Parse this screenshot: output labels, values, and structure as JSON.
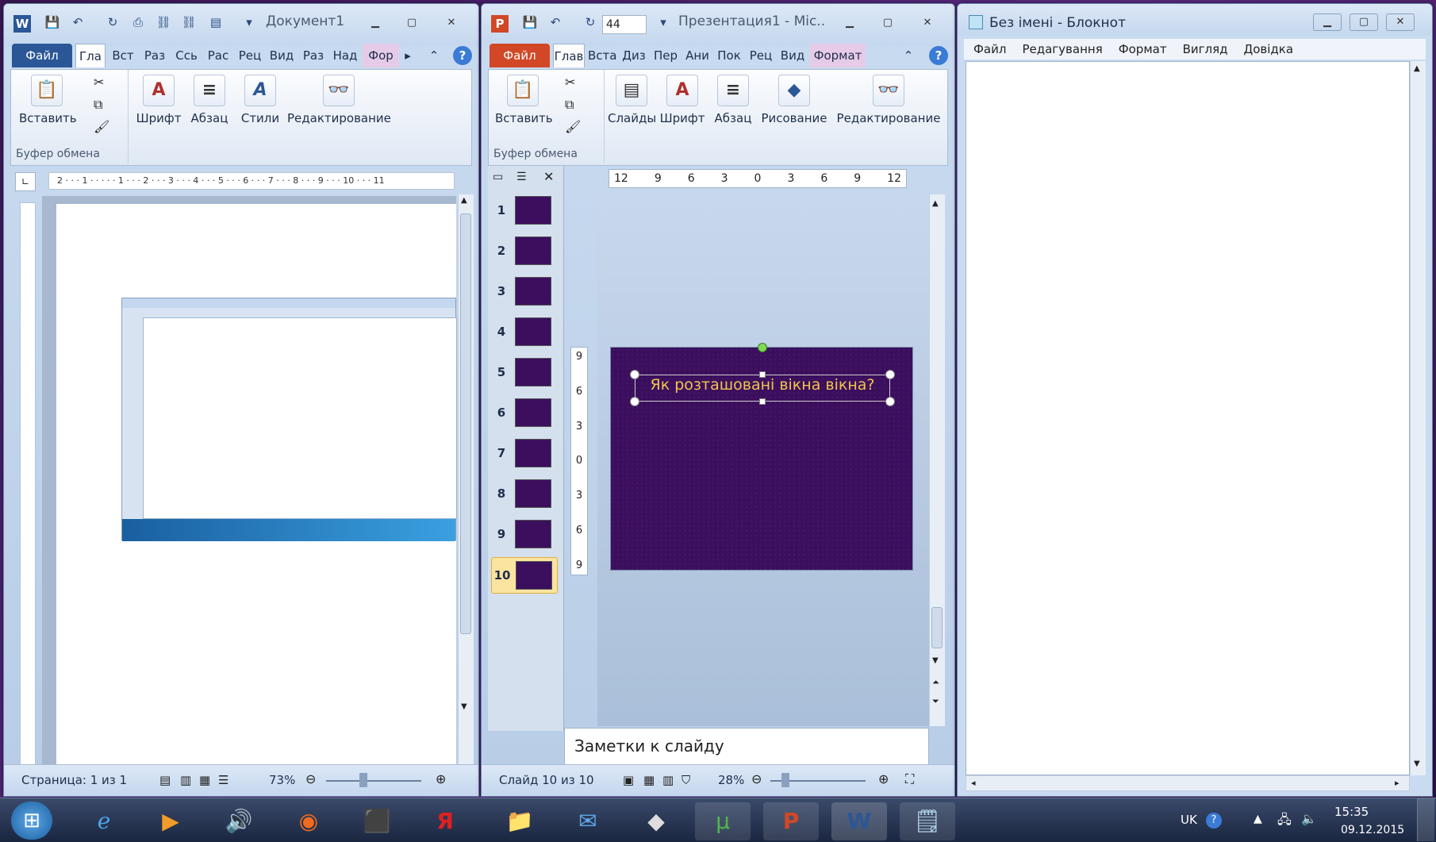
{
  "word": {
    "title": "Документ1",
    "tabs": [
      "Файл",
      "Гла",
      "Вст",
      "Раз",
      "Ссь",
      "Рас",
      "Рец",
      "Вид",
      "Раз",
      "Над",
      "Фор"
    ],
    "ribbon": {
      "paste": "Вставить",
      "font": "Шрифт",
      "paragraph": "Абзац",
      "styles": "Стили",
      "editing": "Редактирование",
      "clipboard": "Буфер обмена"
    },
    "ruler": "2 · · · 1 · · · · · 1 · · · 2 · · · 3 · · · 4 · · · 5 · · · 6 · · · 7 · · · 8 · · · 9 · · · 10 · · · 11",
    "status": {
      "page": "Страница: 1 из 1",
      "zoom": "73%"
    }
  },
  "ppt": {
    "title": "Презентация1  -  Mic...",
    "font_size": "44",
    "tabs": [
      "Файл",
      "Глав",
      "Вста",
      "Диз",
      "Пер",
      "Ани",
      "Пок",
      "Рец",
      "Вид",
      "Формат"
    ],
    "ribbon": {
      "paste": "Вставить",
      "slides": "Слайды",
      "font": "Шрифт",
      "paragraph": "Абзац",
      "drawing": "Рисование",
      "editing": "Редактирование",
      "clipboard": "Буфер обмена"
    },
    "slides": [
      "1",
      "2",
      "3",
      "4",
      "5",
      "6",
      "7",
      "8",
      "9",
      "10"
    ],
    "ruler": [
      "12",
      "9",
      "6",
      "3",
      "0",
      "3",
      "6",
      "9",
      "12"
    ],
    "vruler": [
      "9",
      "6",
      "3",
      "0",
      "3",
      "6",
      "9"
    ],
    "slide_title": "Як розташовані вікна вікна?",
    "notes": "Заметки к слайду",
    "status": {
      "slide": "Слайд 10 из 10",
      "zoom": "28%"
    }
  },
  "notepad": {
    "title": "Без імені - Блокнот",
    "menu": [
      "Файл",
      "Редагування",
      "Формат",
      "Вигляд",
      "Довідка"
    ]
  },
  "taskbar": {
    "lang": "UK",
    "time": "15:35",
    "date": "09.12.2015"
  },
  "colors": {
    "word_file": "#2b5797",
    "ppt_file": "#d24726",
    "slide_bg": "#3b0f5e",
    "slide_text": "#f2c44a"
  }
}
